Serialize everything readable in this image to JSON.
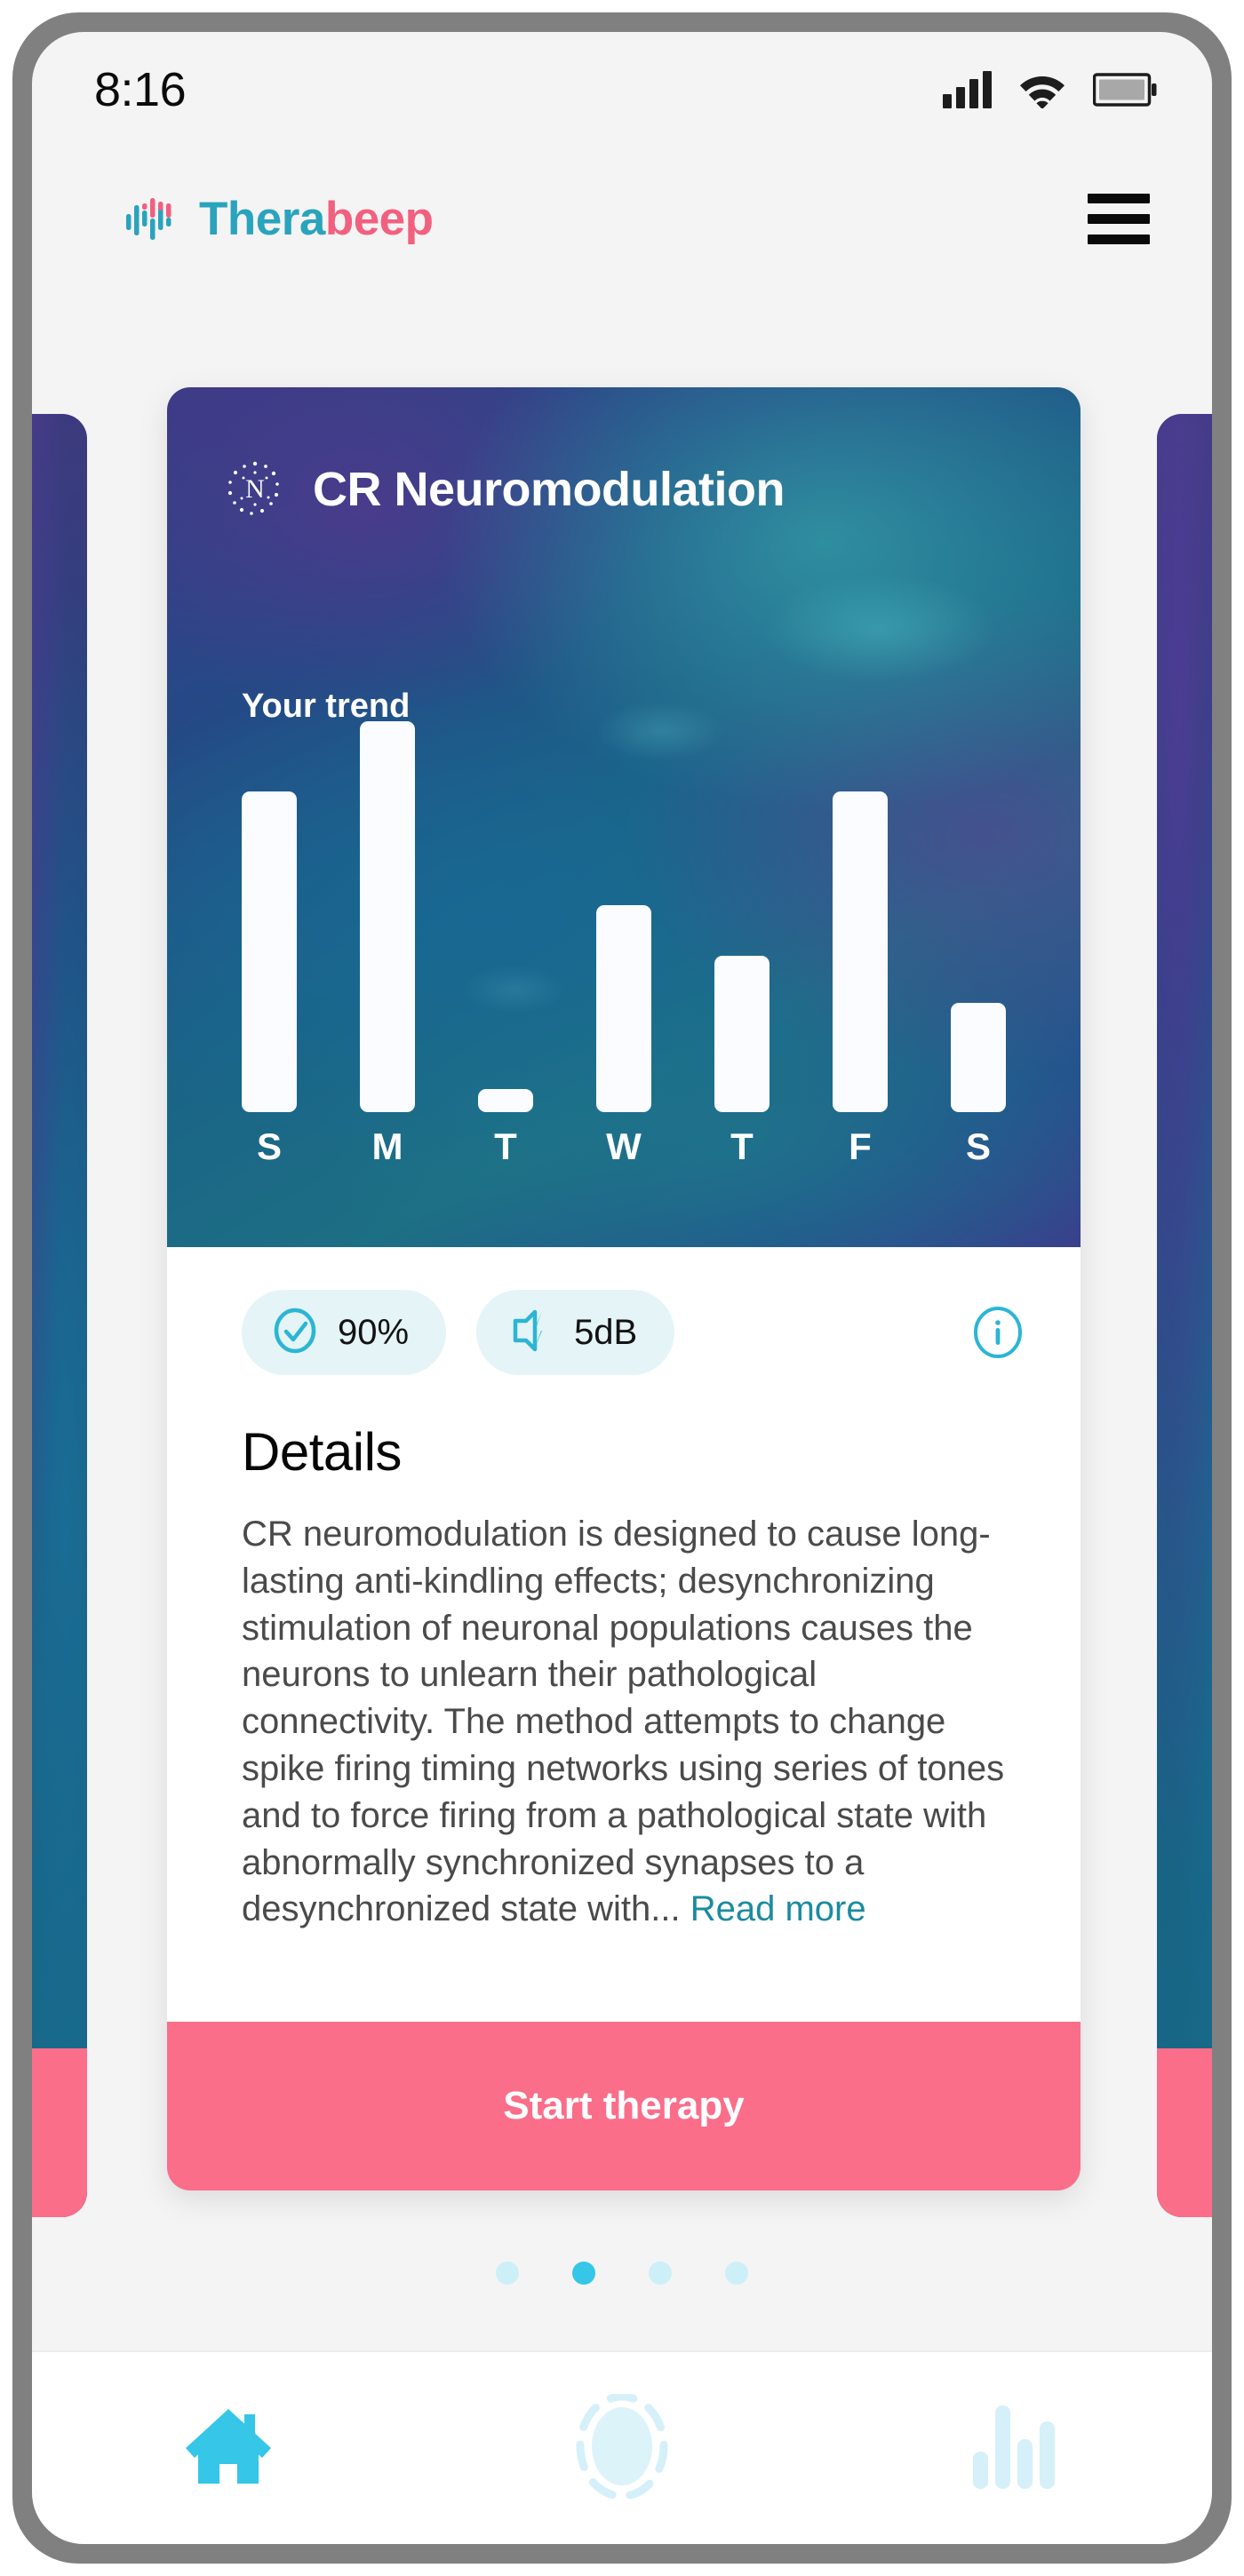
{
  "statusbar": {
    "time": "8:16",
    "signal_icon": "signal-bars-icon",
    "wifi_icon": "wifi-icon",
    "battery_icon": "battery-icon"
  },
  "header": {
    "logo_icon": "waveform-logo-icon",
    "brand_part1": "Thera",
    "brand_part2": "beep",
    "menu_icon": "hamburger-menu-icon",
    "brand_color_teal": "#2aa3bd",
    "brand_color_pink": "#f2607f"
  },
  "card": {
    "emblem_icon": "neuro-n-emblem-icon",
    "title": "CR Neuromodulation",
    "trend_label": "Your trend",
    "stats": [
      {
        "icon": "check-circle-icon",
        "value": "90%"
      },
      {
        "icon": "speaker-bolt-icon",
        "value": "5dB"
      }
    ],
    "info_icon": "info-circle-icon",
    "details_heading": "Details",
    "details_body": "CR neuromodulation is designed to cause long-lasting anti-kindling effects; desynchronizing stimulation of neuronal populations causes the neurons to unlearn their pathological connectivity. The method attempts to change spike firing timing networks using series of tones and to force firing from a pathological state with abnormally synchronized synapses to a desynchronized state with...",
    "read_more": "Read more",
    "cta_label": "Start therapy",
    "cta_color": "#fa6e8a"
  },
  "chart_data": {
    "type": "bar",
    "title": "Your trend",
    "categories": [
      "S",
      "M",
      "T",
      "W",
      "T",
      "F",
      "S"
    ],
    "values": [
      82,
      100,
      6,
      53,
      40,
      82,
      28
    ],
    "xlabel": "",
    "ylabel": "",
    "ylim": [
      0,
      100
    ],
    "grid": false,
    "legend": "none",
    "bar_color": "#fafcff"
  },
  "pagination": {
    "total": 4,
    "active_index": 1,
    "active_color": "#35c6e8",
    "inactive_color": "#cdeff8"
  },
  "bottomnav": {
    "items": [
      {
        "icon": "home-icon",
        "active": true
      },
      {
        "icon": "therapy-circle-icon",
        "active": false
      },
      {
        "icon": "stats-bars-icon",
        "active": false
      }
    ],
    "active_color": "#35c6e8",
    "inactive_color": "#d9f1f8"
  }
}
